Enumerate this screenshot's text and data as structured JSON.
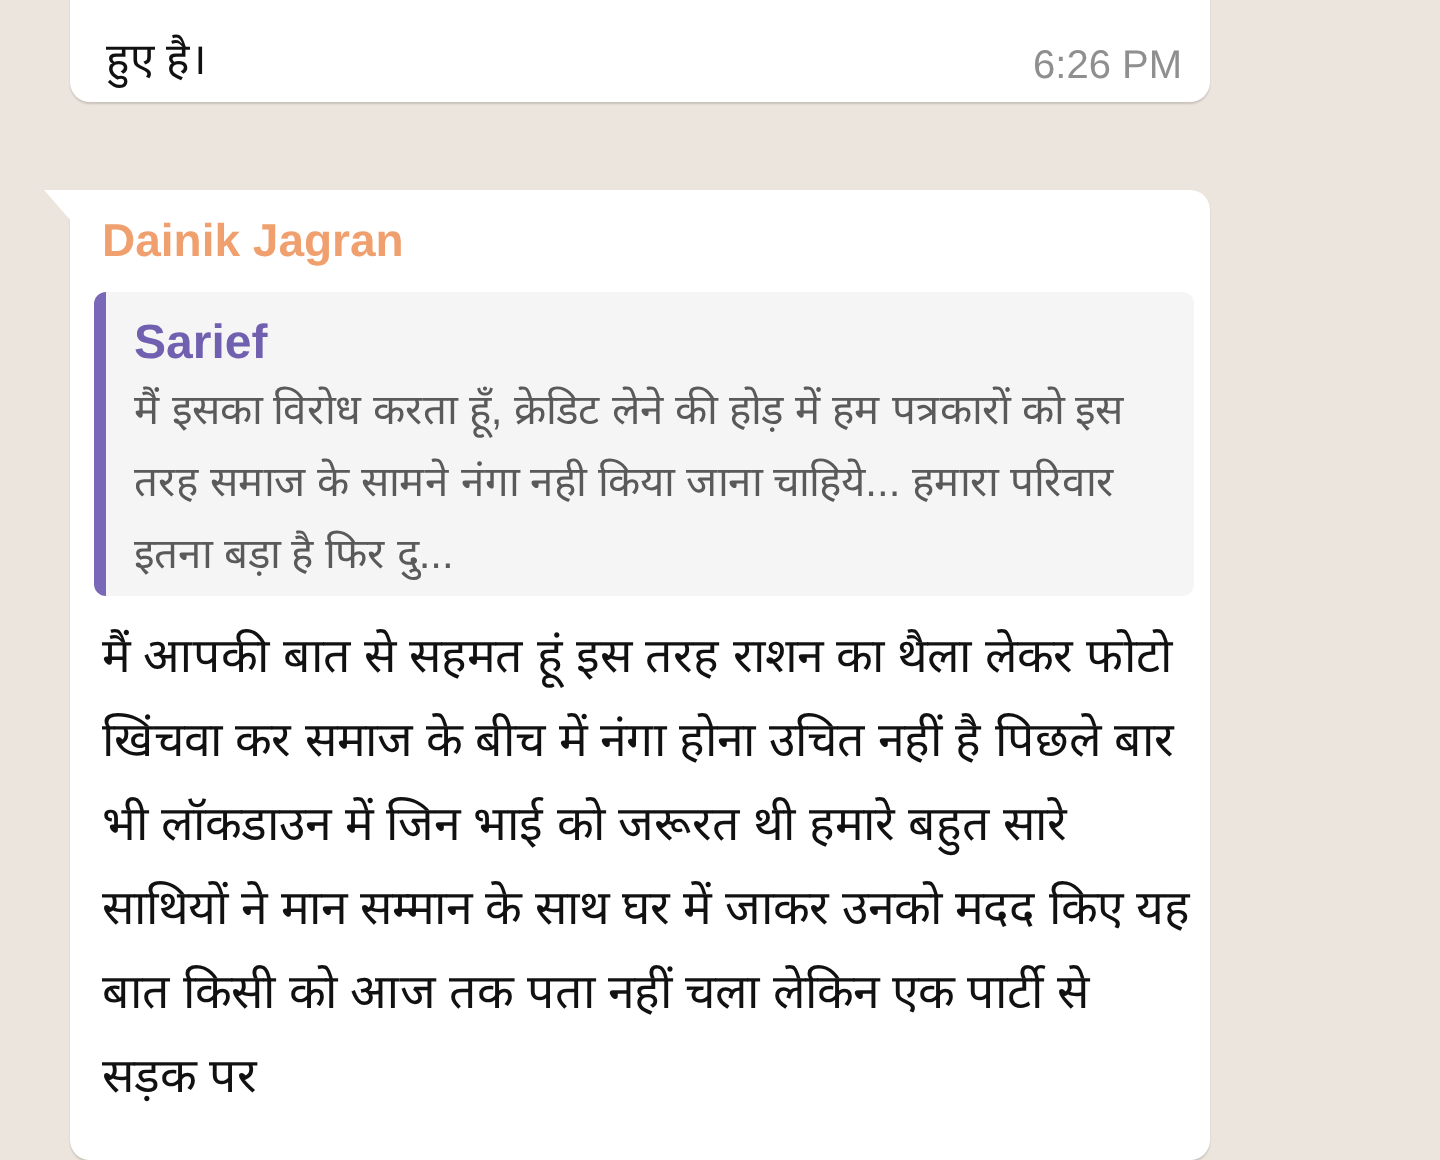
{
  "previous_message": {
    "text": "हुए है।",
    "time": "6:26 PM"
  },
  "message": {
    "sender": "Dainik Jagran",
    "quote": {
      "author": "Sarief",
      "text": "मैं इसका विरोध करता हूँ, क्रेडिट लेने की होड़ में हम पत्रकारों को इस तरह समाज के सामने नंगा नही किया जाना चाहिये... हमारा परिवार इतना बड़ा है फिर दु..."
    },
    "text": "मैं आपकी बात से सहमत हूं इस तरह राशन का थैला लेकर फोटो खिंचवा कर समाज के बीच में नंगा होना उचित नहीं है पिछले बार भी लॉकडाउन में जिन भाई को जरूरत थी हमारे बहुत सारे साथियों ने मान सम्मान के साथ घर में जाकर उनको मदद किए यह बात किसी को आज तक पता नहीं चला लेकिन एक पार्टी से सड़क पर"
  }
}
